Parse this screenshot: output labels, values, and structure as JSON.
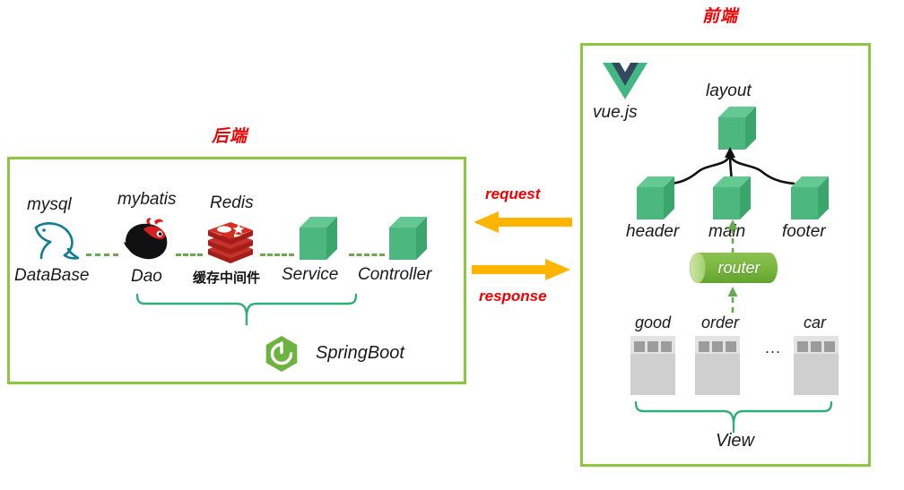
{
  "backend": {
    "title": "后端",
    "nodes": [
      {
        "tech": "mysql",
        "icon": "mysql-dolphin-icon",
        "role": "DataBase"
      },
      {
        "tech": "mybatis",
        "icon": "mybatis-bird-icon",
        "role": "Dao"
      },
      {
        "tech": "Redis",
        "icon": "redis-stack-icon",
        "role": "缓存中间件"
      },
      {
        "tech": "",
        "icon": "green-cube-icon",
        "role": "Service"
      },
      {
        "tech": "",
        "icon": "green-cube-icon",
        "role": "Controller"
      }
    ],
    "framework": {
      "label": "SpringBoot",
      "icon": "springboot-leaf-icon"
    }
  },
  "frontend": {
    "title": "前端",
    "library": {
      "label": "vue.js",
      "icon": "vue-logo-icon"
    },
    "tree": {
      "root": "layout",
      "children": [
        "header",
        "main",
        "footer"
      ]
    },
    "router": {
      "label": "router",
      "icon": "router-cylinder-icon"
    },
    "views": {
      "items": [
        "good",
        "order",
        "car"
      ],
      "ellipsis": "...",
      "group_label": "View"
    }
  },
  "channel": {
    "request_label": "request",
    "response_label": "response",
    "request_icon": "left-arrow-icon",
    "response_icon": "right-arrow-icon"
  },
  "colors": {
    "panel_border": "#8DC63F",
    "title_red": "#F40000",
    "arrow_orange": "#FFB400",
    "cube_green": "#4CB77E",
    "dash_green": "#6AA84F",
    "brace_green": "#2FAE7A",
    "redis_red": "#C6302B",
    "mysql_teal": "#00758F",
    "page_gray": "#CFCFCF"
  }
}
